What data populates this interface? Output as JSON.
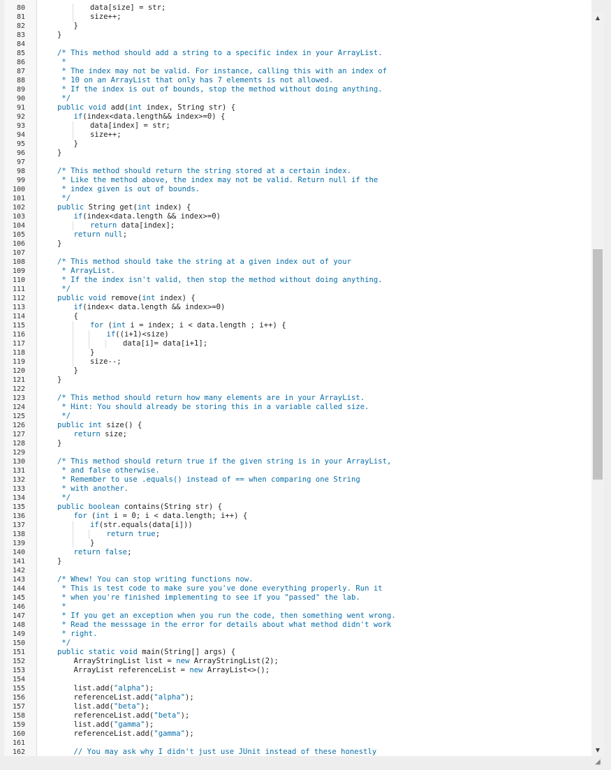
{
  "editor": {
    "lines": [
      {
        "n": "80",
        "indent": 2,
        "text": "data[size] = str;"
      },
      {
        "n": "81",
        "indent": 2,
        "text": "size++;"
      },
      {
        "n": "82",
        "indent": 1,
        "text": "}"
      },
      {
        "n": "83",
        "indent": 0,
        "text": "}"
      },
      {
        "n": "84",
        "indent": 0,
        "text": ""
      },
      {
        "n": "85",
        "indent": 0,
        "text": "/* This method should add a string to a specific index in your ArrayList."
      },
      {
        "n": "86",
        "indent": 0,
        "text": " *"
      },
      {
        "n": "87",
        "indent": 0,
        "text": " * The index may not be valid. For instance, calling this with an index of"
      },
      {
        "n": "88",
        "indent": 0,
        "text": " * 10 on an ArrayList that only has 7 elements is not allowed."
      },
      {
        "n": "89",
        "indent": 0,
        "text": " * If the index is out of bounds, stop the method without doing anything."
      },
      {
        "n": "90",
        "indent": 0,
        "text": " */"
      },
      {
        "n": "91",
        "indent": 0,
        "text": "public void add(int index, String str) {"
      },
      {
        "n": "92",
        "indent": 1,
        "text": "if(index<data.length&& index>=0) {"
      },
      {
        "n": "93",
        "indent": 2,
        "text": "data[index] = str;"
      },
      {
        "n": "94",
        "indent": 2,
        "text": "size++;"
      },
      {
        "n": "95",
        "indent": 1,
        "text": "}"
      },
      {
        "n": "96",
        "indent": 0,
        "text": "}"
      },
      {
        "n": "97",
        "indent": 0,
        "text": ""
      },
      {
        "n": "98",
        "indent": 0,
        "text": "/* This method should return the string stored at a certain index."
      },
      {
        "n": "99",
        "indent": 0,
        "text": " * Like the method above, the index may not be valid. Return null if the"
      },
      {
        "n": "100",
        "indent": 0,
        "text": " * index given is out of bounds."
      },
      {
        "n": "101",
        "indent": 0,
        "text": " */"
      },
      {
        "n": "102",
        "indent": 0,
        "text": "public String get(int index) {"
      },
      {
        "n": "103",
        "indent": 1,
        "text": "if(index<data.length && index>=0)"
      },
      {
        "n": "104",
        "indent": 2,
        "text": "return data[index];"
      },
      {
        "n": "105",
        "indent": 1,
        "text": "return null;"
      },
      {
        "n": "106",
        "indent": 0,
        "text": "}"
      },
      {
        "n": "107",
        "indent": 0,
        "text": ""
      },
      {
        "n": "108",
        "indent": 0,
        "text": "/* This method should take the string at a given index out of your"
      },
      {
        "n": "109",
        "indent": 0,
        "text": " * ArrayList."
      },
      {
        "n": "110",
        "indent": 0,
        "text": " * If the index isn't valid, then stop the method without doing anything."
      },
      {
        "n": "111",
        "indent": 0,
        "text": " */"
      },
      {
        "n": "112",
        "indent": 0,
        "text": "public void remove(int index) {"
      },
      {
        "n": "113",
        "indent": 1,
        "text": "if(index< data.length && index>=0)"
      },
      {
        "n": "114",
        "indent": 1,
        "text": "{"
      },
      {
        "n": "115",
        "indent": 2,
        "text": "for (int i = index; i < data.length ; i++) {"
      },
      {
        "n": "116",
        "indent": 3,
        "text": "if((i+1)<size)"
      },
      {
        "n": "117",
        "indent": 4,
        "text": "data[i]= data[i+1];"
      },
      {
        "n": "118",
        "indent": 2,
        "text": "}"
      },
      {
        "n": "119",
        "indent": 2,
        "text": "size--;"
      },
      {
        "n": "120",
        "indent": 1,
        "text": "}"
      },
      {
        "n": "121",
        "indent": 0,
        "text": "}"
      },
      {
        "n": "122",
        "indent": 0,
        "text": ""
      },
      {
        "n": "123",
        "indent": 0,
        "text": "/* This method should return how many elements are in your ArrayList."
      },
      {
        "n": "124",
        "indent": 0,
        "text": " * Hint: You should already be storing this in a variable called size."
      },
      {
        "n": "125",
        "indent": 0,
        "text": " */"
      },
      {
        "n": "126",
        "indent": 0,
        "text": "public int size() {"
      },
      {
        "n": "127",
        "indent": 1,
        "text": "return size;"
      },
      {
        "n": "128",
        "indent": 0,
        "text": "}"
      },
      {
        "n": "129",
        "indent": 0,
        "text": ""
      },
      {
        "n": "130",
        "indent": 0,
        "text": "/* This method should return true if the given string is in your ArrayList,"
      },
      {
        "n": "131",
        "indent": 0,
        "text": " * and false otherwise."
      },
      {
        "n": "132",
        "indent": 0,
        "text": " * Remember to use .equals() instead of == when comparing one String"
      },
      {
        "n": "133",
        "indent": 0,
        "text": " * with another."
      },
      {
        "n": "134",
        "indent": 0,
        "text": " */"
      },
      {
        "n": "135",
        "indent": 0,
        "text": "public boolean contains(String str) {"
      },
      {
        "n": "136",
        "indent": 1,
        "text": "for (int i = 0; i < data.length; i++) {"
      },
      {
        "n": "137",
        "indent": 2,
        "text": "if(str.equals(data[i]))"
      },
      {
        "n": "138",
        "indent": 3,
        "text": "return true;"
      },
      {
        "n": "139",
        "indent": 2,
        "text": "}"
      },
      {
        "n": "140",
        "indent": 1,
        "text": "return false;"
      },
      {
        "n": "141",
        "indent": 0,
        "text": "}"
      },
      {
        "n": "142",
        "indent": 0,
        "text": ""
      },
      {
        "n": "143",
        "indent": 0,
        "text": "/* Whew! You can stop writing functions now."
      },
      {
        "n": "144",
        "indent": 0,
        "text": " * This is test code to make sure you've done everything properly. Run it"
      },
      {
        "n": "145",
        "indent": 0,
        "text": " * when you're finished implementing to see if you \"passed\" the lab."
      },
      {
        "n": "146",
        "indent": 0,
        "text": " *"
      },
      {
        "n": "147",
        "indent": 0,
        "text": " * If you get an exception when you run the code, then something went wrong."
      },
      {
        "n": "148",
        "indent": 0,
        "text": " * Read the messsage in the error for details about what method didn't work"
      },
      {
        "n": "149",
        "indent": 0,
        "text": " * right."
      },
      {
        "n": "150",
        "indent": 0,
        "text": " */"
      },
      {
        "n": "151",
        "indent": 0,
        "text": "public static void main(String[] args) {"
      },
      {
        "n": "152",
        "indent": 1,
        "text": "ArrayStringList list = new ArrayStringList(2);"
      },
      {
        "n": "153",
        "indent": 1,
        "text": "ArrayList referenceList = new ArrayList<>();"
      },
      {
        "n": "154",
        "indent": 0,
        "text": ""
      },
      {
        "n": "155",
        "indent": 1,
        "text": "list.add(\"alpha\");"
      },
      {
        "n": "156",
        "indent": 1,
        "text": "referenceList.add(\"alpha\");"
      },
      {
        "n": "157",
        "indent": 1,
        "text": "list.add(\"beta\");"
      },
      {
        "n": "158",
        "indent": 1,
        "text": "referenceList.add(\"beta\");"
      },
      {
        "n": "159",
        "indent": 1,
        "text": "list.add(\"gamma\");"
      },
      {
        "n": "160",
        "indent": 1,
        "text": "referenceList.add(\"gamma\");"
      },
      {
        "n": "161",
        "indent": 0,
        "text": ""
      },
      {
        "n": "162",
        "indent": 1,
        "text": "// You may ask why I didn't just use JUnit instead of these honestly"
      }
    ]
  },
  "colors": {
    "comment": "#0a6ea8",
    "keyword": "#0a6ea8",
    "string": "#0a6ea8",
    "text": "#222222",
    "line_number": "#333333"
  },
  "scrollbar": {
    "up_icon": "triangle-up",
    "down_icon": "triangle-down",
    "position_fraction": 0.55
  }
}
